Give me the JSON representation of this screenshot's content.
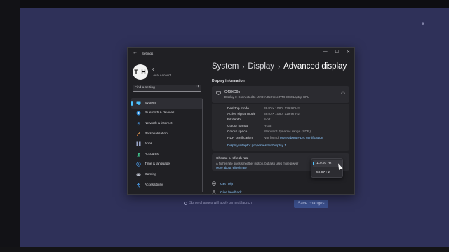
{
  "overlay": {
    "close_glyph": "×",
    "behind_note": "Some changes will apply on next launch",
    "behind_button": "Save changes"
  },
  "window": {
    "title": "Settings",
    "back_glyph": "←",
    "controls": [
      "—",
      "☐",
      "✕"
    ]
  },
  "profile": {
    "initials": "T H",
    "name": "K",
    "account_type": "Local Account"
  },
  "search": {
    "placeholder": "Find a setting",
    "icon": "search-icon"
  },
  "nav": {
    "items": [
      {
        "label": "System",
        "icon": "system-icon",
        "active": true
      },
      {
        "label": "Bluetooth & devices",
        "icon": "bluetooth-icon"
      },
      {
        "label": "Network & internet",
        "icon": "network-icon"
      },
      {
        "label": "Personalisation",
        "icon": "brush-icon"
      },
      {
        "label": "Apps",
        "icon": "apps-icon"
      },
      {
        "label": "Accounts",
        "icon": "accounts-icon"
      },
      {
        "label": "Time & language",
        "icon": "time-language-icon"
      },
      {
        "label": "Gaming",
        "icon": "gaming-icon"
      },
      {
        "label": "Accessibility",
        "icon": "accessibility-icon"
      }
    ]
  },
  "breadcrumb": {
    "part1": "System",
    "part2": "Display",
    "current": "Advanced display",
    "separator": "›"
  },
  "display_info": {
    "section_title": "Display information",
    "monitor_name": "C49HG9x",
    "monitor_sub": "Display 1: Connected to NVIDIA GeForce RTX 3060 Laptop GPU",
    "rows": [
      {
        "key": "Desktop mode",
        "value": "3840 × 1080, 119.97 Hz"
      },
      {
        "key": "Active signal mode",
        "value": "3840 × 1080, 119.97 Hz"
      },
      {
        "key": "Bit depth",
        "value": "8-bit"
      },
      {
        "key": "Colour format",
        "value": "RGB"
      },
      {
        "key": "Colour space",
        "value": "Standard dynamic range (SDR)"
      },
      {
        "key": "HDR certification",
        "value": "Not found",
        "link": "More about HDR certification"
      }
    ],
    "adapter_link": "Display adaptor properties for Display 1"
  },
  "refresh_rate": {
    "title": "Choose a refresh rate",
    "description": "A higher rate gives smoother motion, but also uses more power",
    "link": "More about refresh rate",
    "options": [
      "119.97 Hz",
      "59.97 Hz"
    ],
    "selected": "119.97 Hz"
  },
  "help": {
    "get_help": "Get help",
    "give_feedback": "Give feedback"
  },
  "colors": {
    "accent": "#4cc2ff",
    "link": "#8cc8ff",
    "desktop_blue": "#2f3159"
  }
}
